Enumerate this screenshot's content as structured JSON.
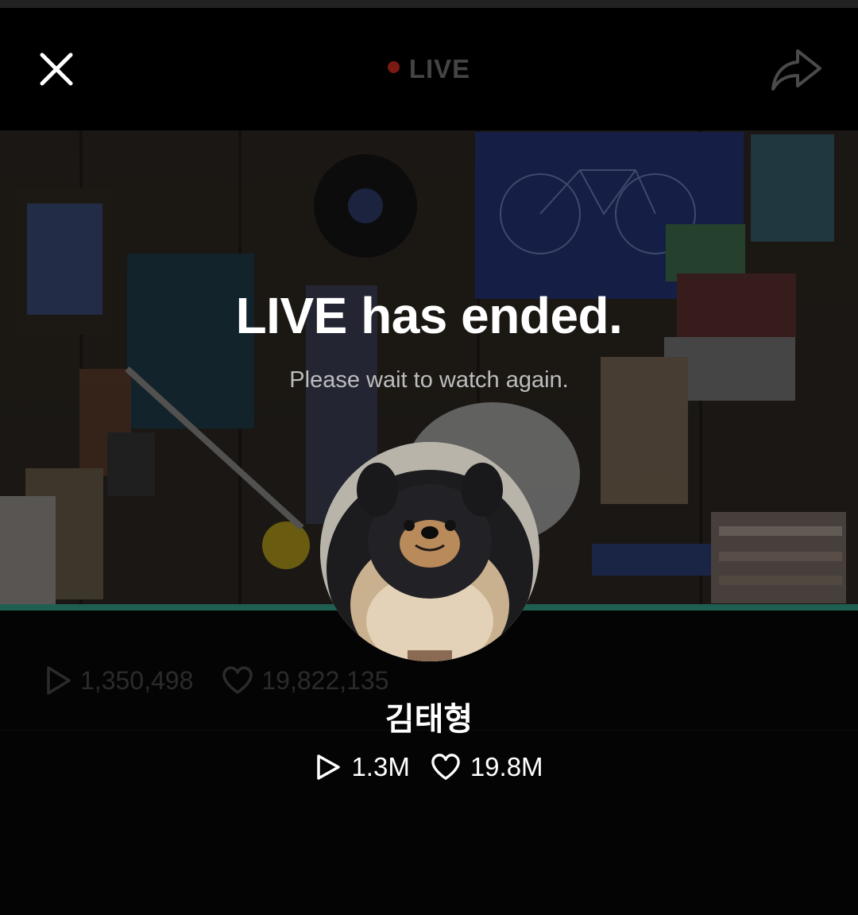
{
  "header": {
    "live_label": "LIVE",
    "live_dot_color": "#7a1a12",
    "close_icon": "close-icon",
    "share_icon": "share-arrow-icon"
  },
  "ended": {
    "title": "LIVE has ended.",
    "subtitle": "Please wait to watch again."
  },
  "background_stats": {
    "plays": "1,350,498",
    "likes": "19,822,135"
  },
  "channel": {
    "name": "김태형",
    "avatar_icon": "pomeranian-avatar"
  },
  "stats": {
    "plays": "1.3M",
    "likes": "19.8M",
    "play_icon": "play-icon",
    "like_icon": "heart-icon"
  },
  "colors": {
    "progress_accent": "#1f5f51",
    "background": "#040404"
  }
}
